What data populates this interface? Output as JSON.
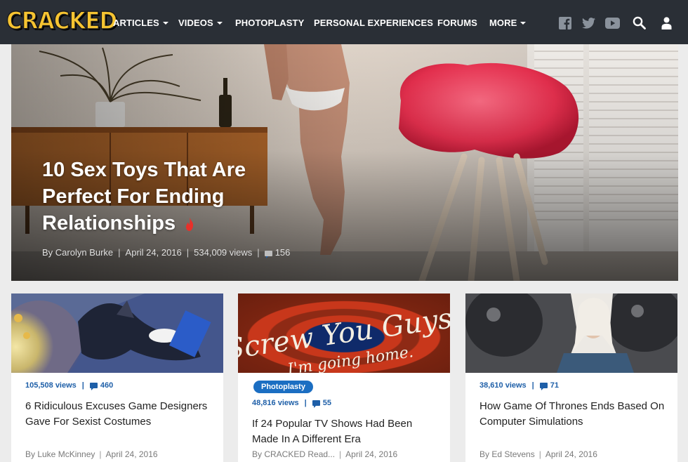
{
  "nav": {
    "logo": "CRACKED",
    "items": [
      {
        "label": "ARTICLES",
        "dropdown": true
      },
      {
        "label": "VIDEOS",
        "dropdown": true
      },
      {
        "label": "PHOTOPLASTY",
        "dropdown": false
      },
      {
        "label": "PERSONAL EXPERIENCES",
        "dropdown": false
      },
      {
        "label": "FORUMS",
        "dropdown": false
      },
      {
        "label": "MORE",
        "dropdown": true
      }
    ],
    "icons": [
      "facebook-icon",
      "twitter-icon",
      "youtube-icon",
      "search-icon",
      "user-icon"
    ]
  },
  "hero": {
    "title": "10 Sex Toys That Are Perfect For Ending Relationships",
    "author": "By Carolyn Burke",
    "date": "April 24, 2016",
    "views": "534,009 views",
    "comments": "156",
    "hot_icon": "flame-icon"
  },
  "cards": [
    {
      "badge": "",
      "views": "105,508 views",
      "comments": "460",
      "title": "6 Ridiculous Excuses Game Designers Gave For Sexist Costumes",
      "author": "By Luke McKinney",
      "date": "April 24, 2016"
    },
    {
      "badge": "Photoplasty",
      "views": "48,816 views",
      "comments": "55",
      "title": "If 24 Popular TV Shows Had Been Made In A Different Era",
      "author": "By CRACKED Read...",
      "date": "April 24, 2016",
      "image_text": [
        "Screw You Guys,",
        "I'm going home."
      ]
    },
    {
      "badge": "",
      "views": "38,610 views",
      "comments": "71",
      "title": "How Game Of Thrones Ends Based On Computer Simulations",
      "author": "By Ed Stevens",
      "date": "April 24, 2016"
    }
  ],
  "colors": {
    "nav_bg": "#2a2f36",
    "logo": "#f6c431",
    "accent_blue": "#1e5fa8",
    "badge_bg": "#1b6ec2",
    "flame": "#e8302a"
  }
}
